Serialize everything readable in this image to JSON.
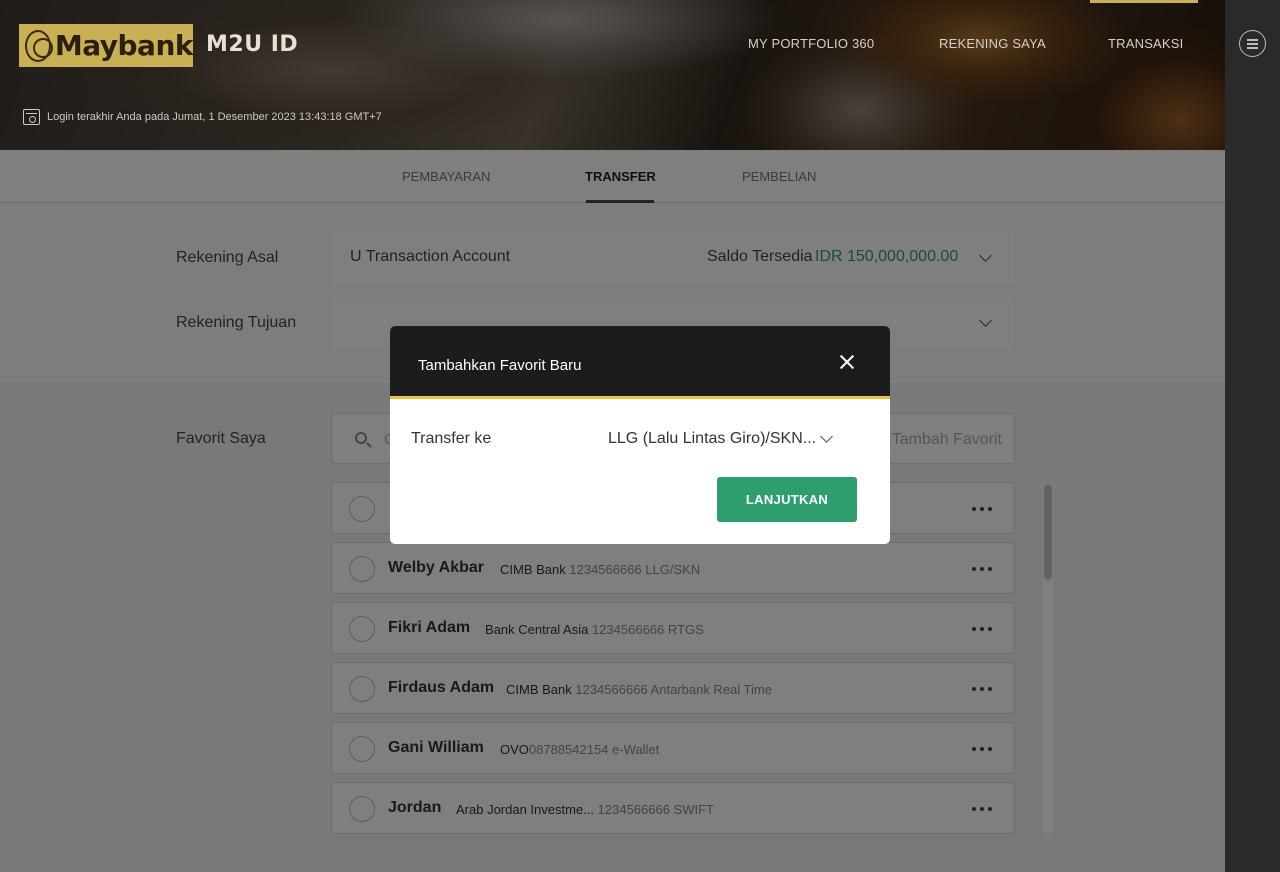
{
  "header": {
    "brand": "Maybank",
    "product": "M2U ID",
    "nav": [
      "MY PORTFOLIO 360",
      "REKENING SAYA",
      "TRANSAKSI"
    ],
    "last_login": "Login terakhir Anda pada Jumat, 1 Desember 2023 13:43:18 GMT+7"
  },
  "tabs": [
    "PEMBAYARAN",
    "TRANSFER",
    "PEMBELIAN"
  ],
  "active_tab": "TRANSFER",
  "form": {
    "source_label": "Rekening Asal",
    "source_value": "U Transaction Account",
    "balance_label": "Saldo Tersedia",
    "balance_value": "IDR 150,000,000.00",
    "dest_label": "Rekening Tujuan",
    "dest_value": ""
  },
  "favorites": {
    "label": "Favorit Saya",
    "search_placeholder": "C",
    "add_label": "Tambah Favorit",
    "items": [
      {
        "name": "",
        "bank": "",
        "detail": ""
      },
      {
        "name": "Welby Akbar",
        "bank": "CIMB Bank",
        "detail": " 1234566666 LLG/SKN"
      },
      {
        "name": "Fikri Adam",
        "bank": "Bank Central Asia",
        "detail": " 1234566666 RTGS"
      },
      {
        "name": "Firdaus Adam",
        "bank": "CIMB Bank",
        "detail": " 1234566666 Antarbank Real Time"
      },
      {
        "name": "Gani William",
        "bank": "OVO",
        "detail": "08788542154 e-Wallet"
      },
      {
        "name": "Jordan",
        "bank": "Arab Jordan Investme...",
        "detail": " 1234566666 SWIFT"
      }
    ]
  },
  "modal": {
    "title": "Tambahkan Favorit Baru",
    "transfer_label": "Transfer ke",
    "transfer_value": "LLG (Lalu Lintas Giro)/SKN...",
    "submit_label": "LANJUTKAN"
  },
  "colors": {
    "accent_green": "#2f9e6e",
    "brand_gold": "#c9b052",
    "modal_stripe": "#f2c233"
  }
}
